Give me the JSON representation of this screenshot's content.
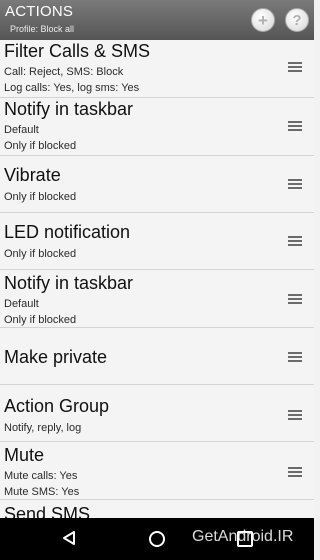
{
  "header": {
    "title": "ACTIONS",
    "subtitle": "Profile: Block all",
    "add_icon": "plus-circle-icon",
    "help_icon": "question-circle-icon",
    "add_glyph": "+",
    "help_glyph": "?"
  },
  "items": [
    {
      "title": "Filter Calls & SMS",
      "line1": "Call: Reject, SMS: Block",
      "line2": "Log calls: Yes, log sms: Yes"
    },
    {
      "title": "Notify in taskbar",
      "line1": "Default",
      "line2": "Only if blocked"
    },
    {
      "title": "Vibrate",
      "line1": "Only if blocked",
      "line2": ""
    },
    {
      "title": "LED notification",
      "line1": "Only if blocked",
      "line2": ""
    },
    {
      "title": "Notify in taskbar",
      "line1": "Default",
      "line2": "Only if blocked"
    },
    {
      "title": "Make private",
      "line1": "",
      "line2": ""
    },
    {
      "title": "Action Group",
      "line1": "Notify, reply, log",
      "line2": ""
    },
    {
      "title": "Mute",
      "line1": "Mute calls: Yes",
      "line2": "Mute SMS: Yes"
    },
    {
      "title": "Send SMS",
      "line1": "",
      "line2": ""
    }
  ],
  "navigation": {
    "back_icon": "back-triangle-icon",
    "home_icon": "home-circle-icon",
    "recents_icon": "recents-square-icon"
  },
  "watermark": "GetAndroid.IR"
}
